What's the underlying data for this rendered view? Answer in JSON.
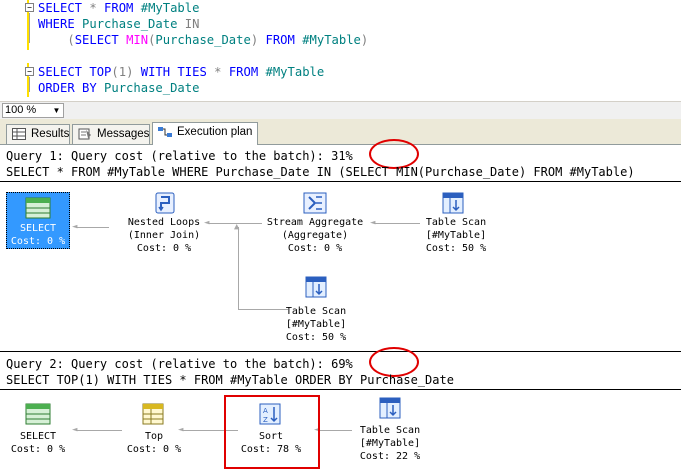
{
  "editor": {
    "lines": [
      {
        "segments": [
          {
            "t": "SELECT",
            "c": "kw"
          },
          {
            "t": " * ",
            "c": "gr"
          },
          {
            "t": "FROM",
            "c": "kw"
          },
          {
            "t": " #MyTable",
            "c": "id"
          }
        ]
      },
      {
        "segments": [
          {
            "t": "WHERE",
            "c": "kw"
          },
          {
            "t": " Purchase_Date ",
            "c": "id"
          },
          {
            "t": "IN",
            "c": "gr"
          }
        ]
      },
      {
        "segments": [
          {
            "t": "    (",
            "c": "gr"
          },
          {
            "t": "SELECT",
            "c": "kw"
          },
          {
            "t": " ",
            "c": ""
          },
          {
            "t": "MIN",
            "c": "fn"
          },
          {
            "t": "(",
            "c": "gr"
          },
          {
            "t": "Purchase_Date",
            "c": "id"
          },
          {
            "t": ") ",
            "c": "gr"
          },
          {
            "t": "FROM",
            "c": "kw"
          },
          {
            "t": " #MyTable",
            "c": "id"
          },
          {
            "t": ")",
            "c": "gr"
          }
        ]
      },
      {
        "segments": [
          {
            "t": "",
            "c": ""
          }
        ]
      },
      {
        "segments": [
          {
            "t": "SELECT",
            "c": "kw"
          },
          {
            "t": " TOP",
            "c": "kw"
          },
          {
            "t": "(1) ",
            "c": "gr"
          },
          {
            "t": "WITH TIES",
            "c": "kw"
          },
          {
            "t": " * ",
            "c": "gr"
          },
          {
            "t": "FROM",
            "c": "kw"
          },
          {
            "t": " #MyTable",
            "c": "id"
          }
        ]
      },
      {
        "segments": [
          {
            "t": "ORDER BY",
            "c": "kw"
          },
          {
            "t": " Purchase_Date",
            "c": "id"
          }
        ]
      }
    ]
  },
  "zoom": {
    "value": "100 %"
  },
  "tabs": [
    {
      "label": "Results",
      "icon": "grid-icon"
    },
    {
      "label": "Messages",
      "icon": "messages-icon"
    },
    {
      "label": "Execution plan",
      "icon": "execution-plan-icon"
    }
  ],
  "query1": {
    "header_prefix": "Query 1: Query cost (relative to the batch): ",
    "cost": "31%",
    "sql": "SELECT * FROM #MyTable WHERE Purchase_Date IN (SELECT MIN(Purchase_Date) FROM #MyTable)",
    "nodes": {
      "select": {
        "l1": "SELECT",
        "l2": "Cost: 0 %"
      },
      "nested_loops": {
        "l1": "Nested Loops",
        "l2": "(Inner Join)",
        "l3": "Cost: 0 %"
      },
      "stream_agg": {
        "l1": "Stream Aggregate",
        "l2": "(Aggregate)",
        "l3": "Cost: 0 %"
      },
      "scan1": {
        "l1": "Table Scan",
        "l2": "[#MyTable]",
        "l3": "Cost: 50 %"
      },
      "scan2": {
        "l1": "Table Scan",
        "l2": "[#MyTable]",
        "l3": "Cost: 50 %"
      }
    }
  },
  "query2": {
    "header_prefix": "Query 2: Query cost (relative to the batch): ",
    "cost": "69%",
    "sql": "SELECT TOP(1) WITH TIES * FROM #MyTable ORDER BY Purchase_Date",
    "nodes": {
      "select": {
        "l1": "SELECT",
        "l2": "Cost: 0 %"
      },
      "top": {
        "l1": "Top",
        "l2": "Cost: 0 %"
      },
      "sort": {
        "l1": "Sort",
        "l2": "Cost: 78 %"
      },
      "scan": {
        "l1": "Table Scan",
        "l2": "[#MyTable]",
        "l3": "Cost: 22 %"
      }
    }
  },
  "colors": {
    "highlight": "#e00000",
    "selected": "#3399ff",
    "keyword": "#0000ff",
    "function": "#ff00ff",
    "identifier": "#008080"
  }
}
